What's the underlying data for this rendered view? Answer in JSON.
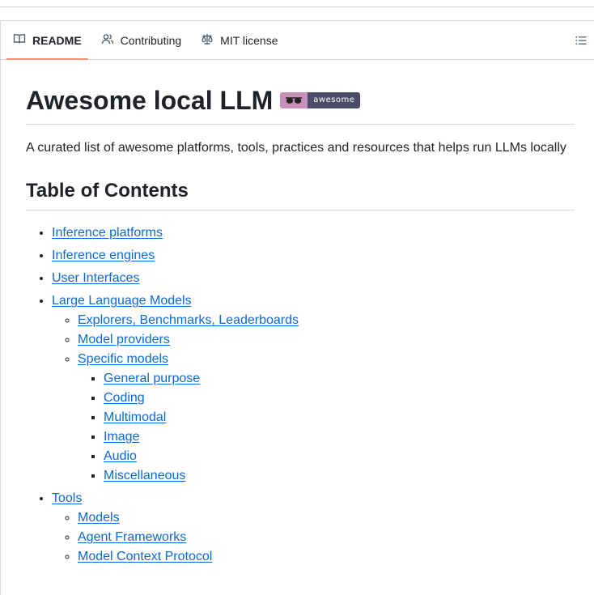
{
  "tabs": [
    {
      "label": "README",
      "icon": "book-icon",
      "active": true
    },
    {
      "label": "Contributing",
      "icon": "people-icon",
      "active": false
    },
    {
      "label": "MIT license",
      "icon": "law-icon",
      "active": false
    }
  ],
  "title": "Awesome local LLM",
  "badge": {
    "text": "awesome",
    "left_color": "#c590b9",
    "right_color": "#4d4d6a"
  },
  "description": "A curated list of awesome platforms, tools, practices and resources that helps run LLMs locally",
  "toc_heading": "Table of Contents",
  "toc": [
    {
      "label": "Inference platforms"
    },
    {
      "label": "Inference engines"
    },
    {
      "label": "User Interfaces"
    },
    {
      "label": "Large Language Models",
      "children": [
        {
          "label": "Explorers, Benchmarks, Leaderboards"
        },
        {
          "label": "Model providers"
        },
        {
          "label": "Specific models",
          "children": [
            {
              "label": "General purpose"
            },
            {
              "label": "Coding"
            },
            {
              "label": "Multimodal"
            },
            {
              "label": "Image"
            },
            {
              "label": "Audio"
            },
            {
              "label": "Miscellaneous"
            }
          ]
        }
      ]
    },
    {
      "label": "Tools",
      "children": [
        {
          "label": "Models"
        },
        {
          "label": "Agent Frameworks"
        },
        {
          "label": "Model Context Protocol"
        }
      ]
    }
  ],
  "colors": {
    "link": "#0969da",
    "active_tab_underline": "#fd8c73",
    "border": "#d1d9e0"
  }
}
